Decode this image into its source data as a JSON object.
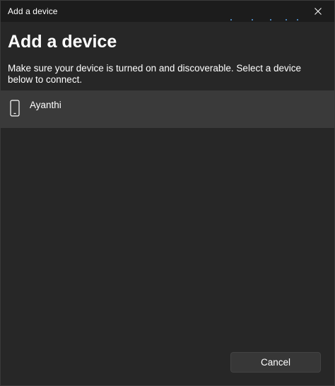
{
  "window": {
    "title": "Add a device",
    "close_icon": "close-icon"
  },
  "main": {
    "heading": "Add a device",
    "description": "Make sure your device is turned on and discoverable. Select a device below to connect.",
    "devices": [
      {
        "name": "Ayanthi",
        "icon": "phone-icon"
      }
    ]
  },
  "footer": {
    "cancel_label": "Cancel"
  },
  "colors": {
    "background": "#272727",
    "titlebar": "#1c1c1c",
    "selected_item": "#3a3a3a",
    "accent": "#5aa7ef"
  }
}
